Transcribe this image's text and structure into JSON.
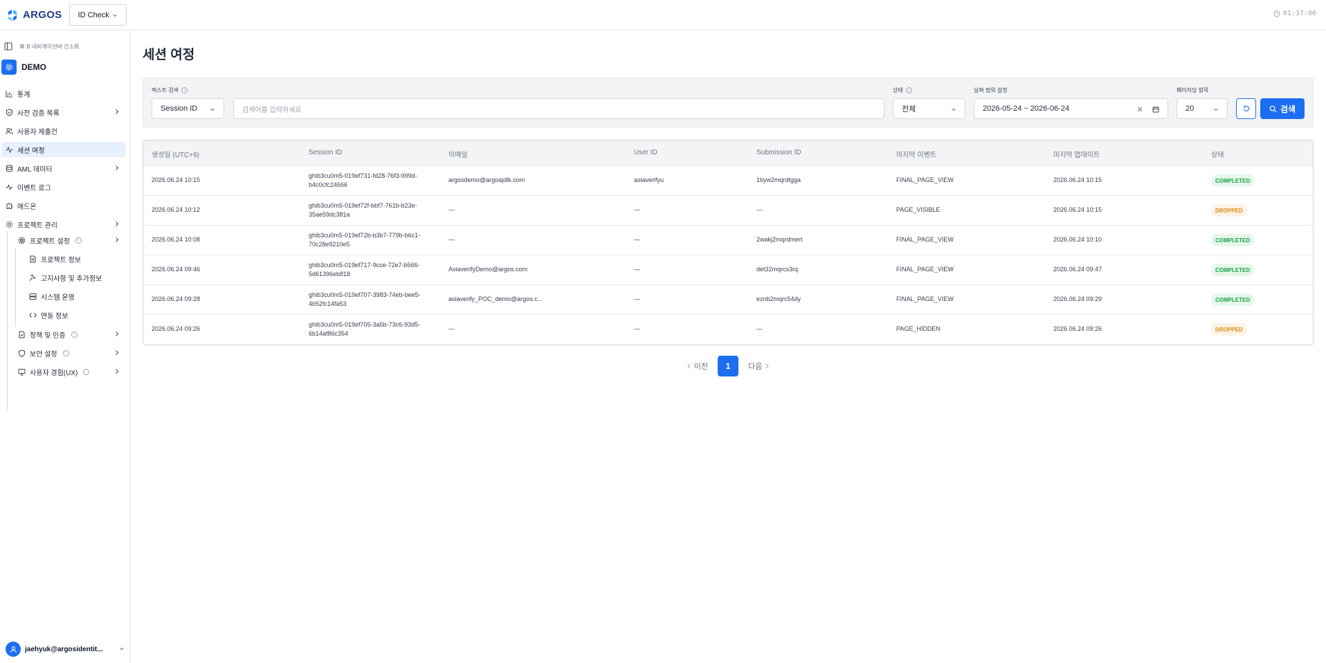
{
  "topbar": {
    "brand": "ARGOS",
    "product": "ID Check",
    "time": "01:37:06",
    "colors": {
      "brand_blue": "#1d6ff2",
      "logo_dark": "#1e3a8a"
    }
  },
  "sidebar": {
    "toggle_hint": "⌘ B 네비게이션바 간소화",
    "project_name": "DEMO",
    "items": [
      {
        "label": "통계",
        "icon": "chart-icon"
      },
      {
        "label": "사전 검증 목록",
        "icon": "shield-check-icon"
      },
      {
        "label": "사용자 제출건",
        "icon": "users-icon"
      },
      {
        "label": "세션 여정",
        "icon": "activity-icon",
        "active": true
      },
      {
        "label": "AML 데이터",
        "icon": "database-icon"
      },
      {
        "label": "이벤트 로그",
        "icon": "pulse-icon"
      },
      {
        "label": "애드온",
        "icon": "puzzle-icon"
      },
      {
        "label": "프로젝트 관리",
        "icon": "gear-icon"
      }
    ],
    "project_settings": {
      "label": "프로젝트 설정",
      "children": [
        "프로젝트 정보",
        "고지사항 및 추가정보",
        "시스템 운영",
        "연동 정보"
      ]
    },
    "more_items": [
      "정책 및 인증",
      "보안 설정",
      "사용자 경험(UX)"
    ],
    "user_email": "jaehyuk@argosidentit..."
  },
  "main": {
    "title": "세션 여정",
    "filters": {
      "text_search_label": "텍스트 검색",
      "search_type": "Session ID",
      "search_placeholder": "검색어를 입력하세요",
      "status_label": "상태",
      "status_value": "전체",
      "date_label": "날짜 범위 설정",
      "date_value": "2026-05-24 ~ 2026-06-24",
      "page_size_label": "페이지당 항목",
      "page_size_value": "20",
      "search_button": "검색"
    },
    "table": {
      "headers": [
        "생성일 (UTC+9)",
        "Session ID",
        "이메일",
        "User ID",
        "Submission ID",
        "마지막 이벤트",
        "마지막 업데이트",
        "상태"
      ],
      "rows": [
        {
          "created": "2026.06.24 10:15",
          "session_id": "ghib3cu0m5-019ef731-fd28-76f3-999d-b4c0cfc24666",
          "email": "argosdemo@argoajdlk.com",
          "user_id": "asiaverifyu",
          "submission_id": "1byw2mqrdtgga",
          "last_event": "FINAL_PAGE_VIEW",
          "last_update": "2026.06.24 10:15",
          "status": "COMPLETED"
        },
        {
          "created": "2026.06.24 10:12",
          "session_id": "ghib3cu0m5-019ef72f-bbf7-761b-b23e-35ae59dc381a",
          "email": "—",
          "user_id": "—",
          "submission_id": "—",
          "last_event": "PAGE_VISIBLE",
          "last_update": "2026.06.24 10:15",
          "status": "DROPPED"
        },
        {
          "created": "2026.06.24 10:08",
          "session_id": "ghib3cu0m5-019ef72b-b3b7-779b-b6c1-70c28e9210e5",
          "email": "—",
          "user_id": "—",
          "submission_id": "2wakj2mqrdmert",
          "last_event": "FINAL_PAGE_VIEW",
          "last_update": "2026.06.24 10:10",
          "status": "COMPLETED"
        },
        {
          "created": "2026.06.24 09:46",
          "session_id": "ghib3cu0m5-019ef717-9cce-72e7-b566-5d61396eb818",
          "email": "AsiaverifyDemo@argos.com",
          "user_id": "—",
          "submission_id": "det32mqrcs3rq",
          "last_event": "FINAL_PAGE_VIEW",
          "last_update": "2026.06.24 09:47",
          "status": "COMPLETED"
        },
        {
          "created": "2026.06.24 09:28",
          "session_id": "ghib3cu0m5-019ef707-3983-74eb-bee5-4b52fc14fa53",
          "email": "asiaverify_POC_demo@argos.c...",
          "user_id": "—",
          "submission_id": "eznb2mqrc54dy",
          "last_event": "FINAL_PAGE_VIEW",
          "last_update": "2026.06.24 09:29",
          "status": "COMPLETED"
        },
        {
          "created": "2026.06.24 09:26",
          "session_id": "ghib3cu0m5-019ef705-3a5b-73c6-93d5-6b14af86c354",
          "email": "—",
          "user_id": "—",
          "submission_id": "—",
          "last_event": "PAGE_HIDDEN",
          "last_update": "2026.06.24 09:26",
          "status": "DROPPED"
        }
      ]
    },
    "pagination": {
      "prev": "이전",
      "page": "1",
      "next": "다음"
    },
    "status_colors": {
      "completed": "#16a34a",
      "dropped": "#e08a12"
    }
  }
}
